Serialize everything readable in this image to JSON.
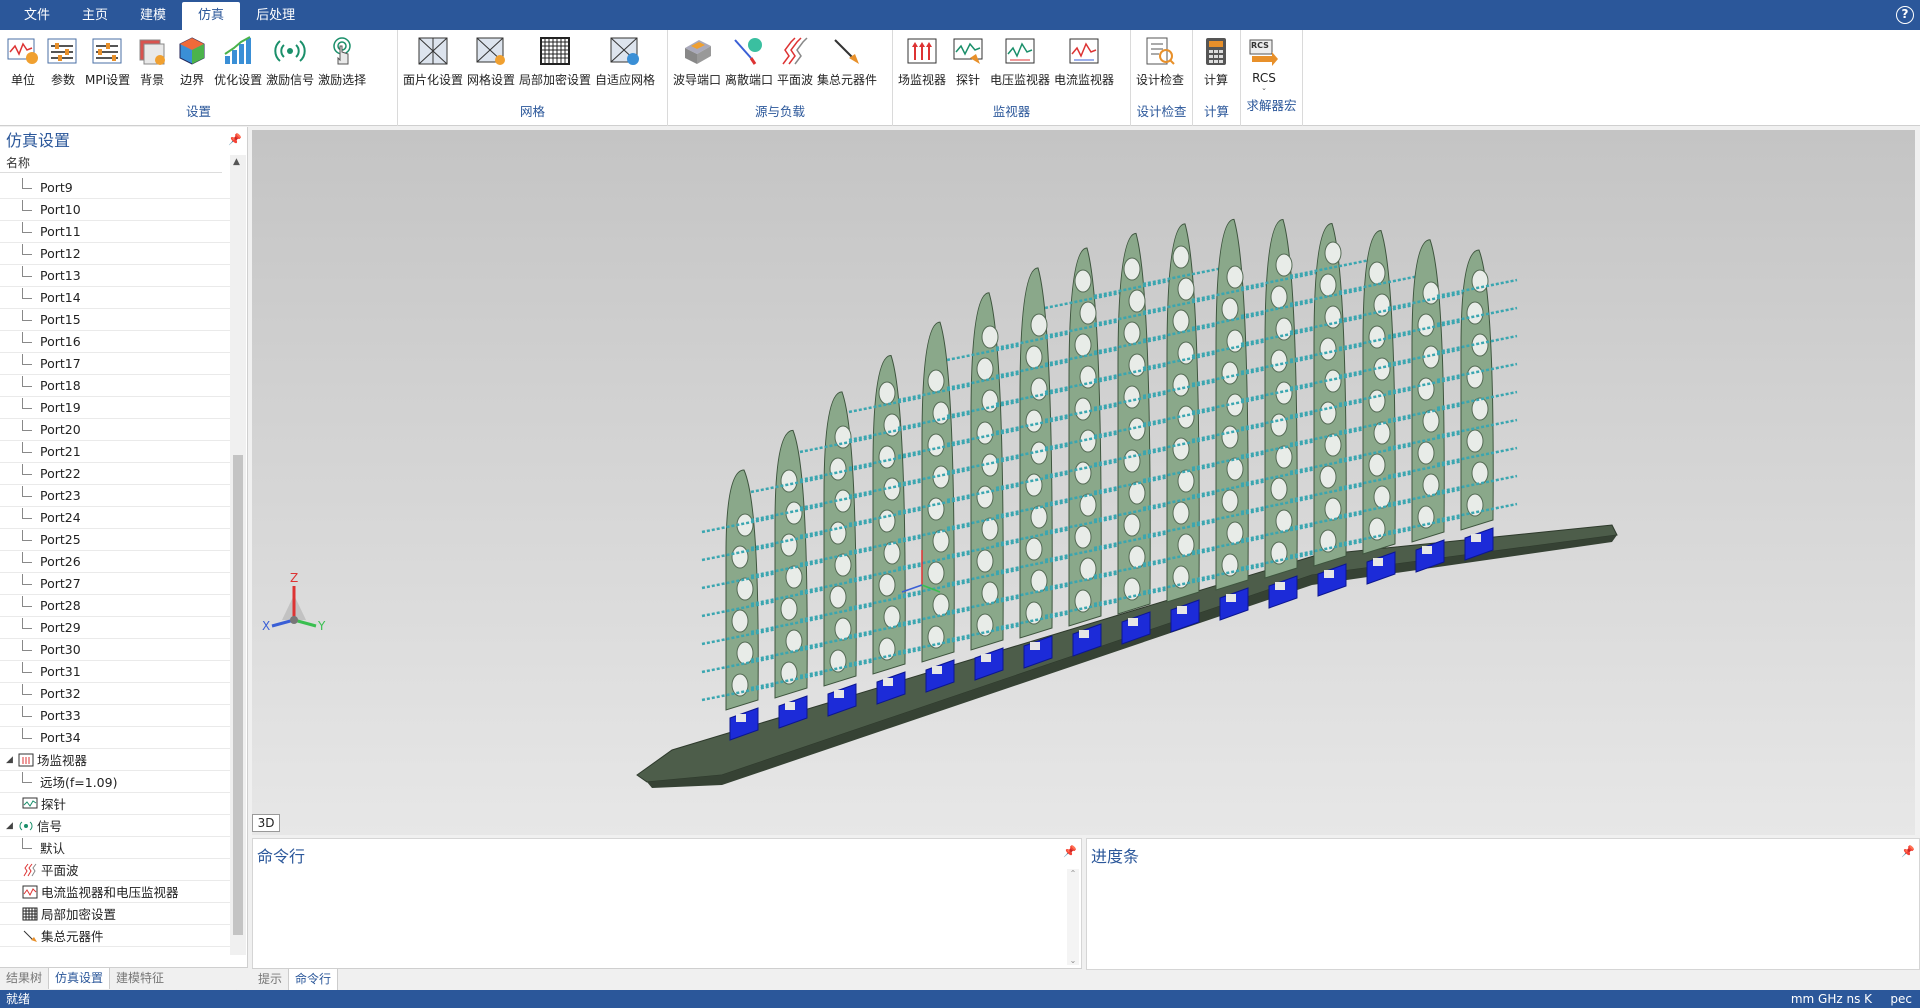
{
  "menu": {
    "tabs": [
      "文件",
      "主页",
      "建模",
      "仿真",
      "后处理"
    ],
    "active": "仿真",
    "help": "?"
  },
  "ribbon": {
    "groups": [
      {
        "label": "设置",
        "buttons": [
          "单位",
          "参数",
          "MPI设置",
          "背景",
          "边界",
          "优化设置",
          "激励信号",
          "激励选择"
        ]
      },
      {
        "label": "网格",
        "buttons": [
          "面片化设置",
          "网格设置",
          "局部加密设置",
          "自适应网格"
        ]
      },
      {
        "label": "源与负载",
        "buttons": [
          "波导端口",
          "离散端口",
          "平面波",
          "集总元器件"
        ]
      },
      {
        "label": "监视器",
        "buttons": [
          "场监视器",
          "探针",
          "电压监视器",
          "电流监视器"
        ]
      },
      {
        "label": "设计检查",
        "buttons": [
          "设计检查"
        ]
      },
      {
        "label": "计算",
        "buttons": [
          "计算"
        ]
      },
      {
        "label": "求解器宏",
        "buttons": [
          "RCS"
        ]
      }
    ],
    "rcs_icon_text": "RCS"
  },
  "left_panel": {
    "title": "仿真设置",
    "column_header": "名称",
    "ports": [
      "Port9",
      "Port10",
      "Port11",
      "Port12",
      "Port13",
      "Port14",
      "Port15",
      "Port16",
      "Port17",
      "Port18",
      "Port19",
      "Port20",
      "Port21",
      "Port22",
      "Port23",
      "Port24",
      "Port25",
      "Port26",
      "Port27",
      "Port28",
      "Port29",
      "Port30",
      "Port31",
      "Port32",
      "Port33",
      "Port34"
    ],
    "field_monitor": "场监视器",
    "far_field": "远场(f=1.09)",
    "probe": "探针",
    "signal": "信号",
    "signal_default": "默认",
    "plane_wave": "平面波",
    "cv_monitors": "电流监视器和电压监视器",
    "local_refine": "局部加密设置",
    "lumped": "集总元器件",
    "tabs": [
      "结果树",
      "仿真设置",
      "建模特征"
    ],
    "active_tab": "仿真设置"
  },
  "viewport": {
    "view_label": "3D",
    "axis": {
      "x": "X",
      "y": "Y",
      "z": "Z"
    }
  },
  "command_panel": {
    "title": "命令行",
    "tabs": [
      "提示",
      "命令行"
    ],
    "active_tab": "命令行"
  },
  "progress_panel": {
    "title": "进度条"
  },
  "status": {
    "left": "就绪",
    "units": "mm GHz ns K",
    "material": "pec"
  },
  "colors": {
    "accent": "#2b579a",
    "fin_green": "#8aa88a",
    "port_blue": "#1c2bd8",
    "rod_cyan": "#3aa6b0"
  }
}
